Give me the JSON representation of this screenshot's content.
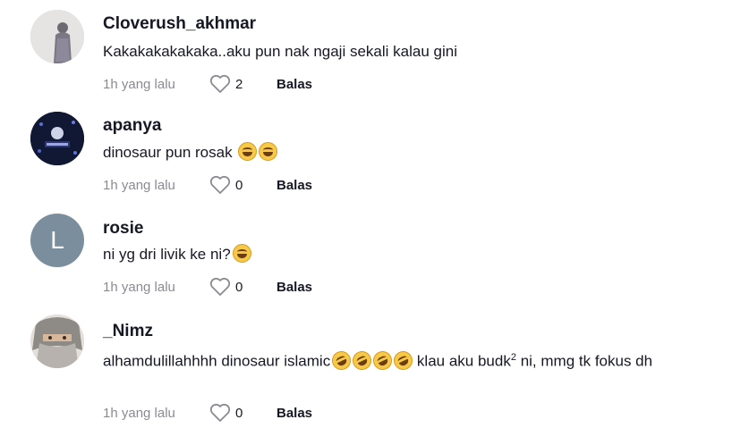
{
  "comments": [
    {
      "username": "Cloverush_akhmar",
      "text": "Kakakakakakaka..aku pun nak ngaji sekali kalau gini",
      "time": "1h yang lalu",
      "likes": "2",
      "reply": "Balas"
    },
    {
      "username": "apanya",
      "text": "dinosaur pun rosak",
      "time": "1h yang lalu",
      "likes": "0",
      "reply": "Balas"
    },
    {
      "username": "rosie",
      "avatar_letter": "L",
      "text": "ni yg dri livik ke ni?",
      "time": "1h yang lalu",
      "likes": "0",
      "reply": "Balas"
    },
    {
      "username": "_Nimz",
      "text_part1": "alhamdulillahhhh dinosaur islamic",
      "text_part2": " klau aku budk",
      "text_sup": "2",
      "text_part3": " ni, mmg tk fokus dh",
      "time": "1h yang lalu",
      "likes": "0",
      "reply": "Balas"
    }
  ],
  "colors": {
    "avatar_letter_bg": "#7a8e9e",
    "muted_text": "#8a8b91"
  },
  "icons": [
    "heart-outline-icon",
    "grinning-sweat-emoji",
    "rofl-emoji"
  ]
}
